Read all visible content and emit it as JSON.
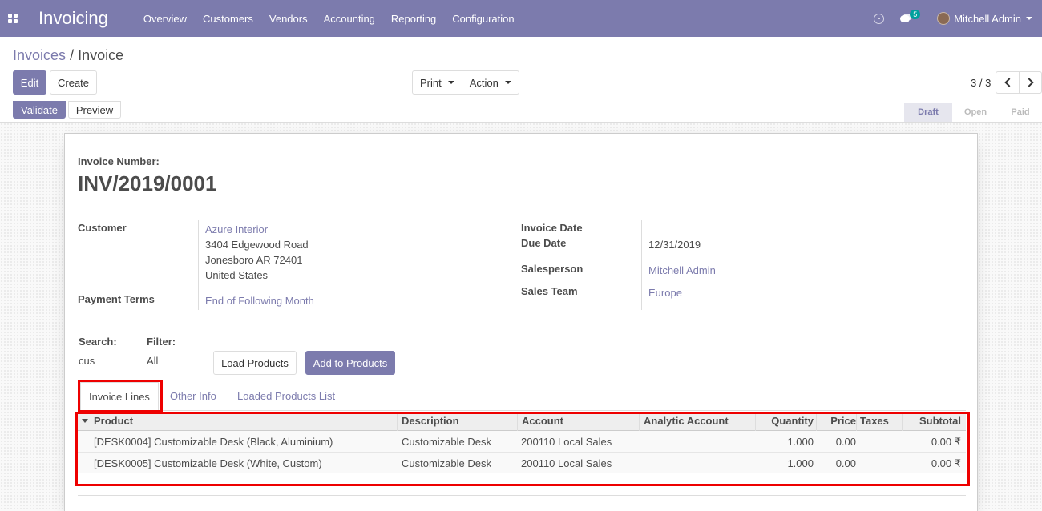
{
  "navbar": {
    "app_title": "Invoicing",
    "menu": [
      "Overview",
      "Customers",
      "Vendors",
      "Accounting",
      "Reporting",
      "Configuration"
    ],
    "messages_badge": "5",
    "user_name": "Mitchell Admin"
  },
  "breadcrumb": {
    "parent": "Invoices",
    "separator": "/",
    "current": "Invoice"
  },
  "toolbar": {
    "edit": "Edit",
    "create": "Create",
    "print": "Print",
    "action": "Action",
    "pager": "3 / 3"
  },
  "statusbar": {
    "validate": "Validate",
    "preview": "Preview",
    "stages": [
      "Draft",
      "Open",
      "Paid"
    ],
    "active_stage": "Draft"
  },
  "form": {
    "number_label": "Invoice Number:",
    "number": "INV/2019/0001",
    "customer_label": "Customer",
    "customer_name": "Azure Interior",
    "address": [
      "3404 Edgewood Road",
      "Jonesboro AR 72401",
      "United States"
    ],
    "payment_terms_label": "Payment Terms",
    "payment_terms": "End of Following Month",
    "invoice_date_label": "Invoice Date",
    "invoice_date": "",
    "due_date_label": "Due Date",
    "due_date": "12/31/2019",
    "salesperson_label": "Salesperson",
    "salesperson": "Mitchell Admin",
    "sales_team_label": "Sales Team",
    "sales_team": "Europe",
    "search_label": "Search:",
    "search_value": "cus",
    "filter_label": "Filter:",
    "filter_value": "All",
    "load_products": "Load Products",
    "add_to_products": "Add to Products"
  },
  "tabs": [
    "Invoice Lines",
    "Other Info",
    "Loaded Products List"
  ],
  "table": {
    "columns": [
      "Product",
      "Description",
      "Account",
      "Analytic Account",
      "Quantity",
      "Price",
      "Taxes",
      "Subtotal"
    ],
    "rows": [
      {
        "product": "[DESK0004] Customizable Desk (Black, Aluminium)",
        "description": "Customizable Desk",
        "account": "200110 Local Sales",
        "analytic": "",
        "quantity": "1.000",
        "price": "0.00",
        "taxes": "",
        "subtotal": "0.00 ₹"
      },
      {
        "product": "[DESK0005] Customizable Desk (White, Custom)",
        "description": "Customizable Desk",
        "account": "200110 Local Sales",
        "analytic": "",
        "quantity": "1.000",
        "price": "0.00",
        "taxes": "",
        "subtotal": "0.00 ₹"
      }
    ]
  },
  "colors": {
    "brand": "#7c7bad",
    "highlight": "#ee0000"
  }
}
